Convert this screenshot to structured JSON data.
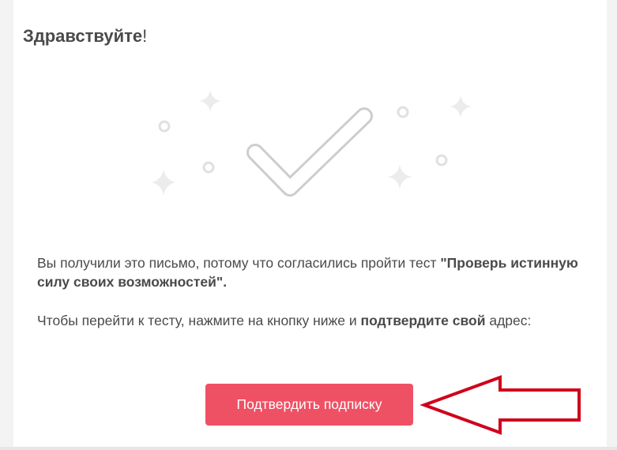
{
  "greeting": {
    "word": "Здравствуйте",
    "punct": "!"
  },
  "message": {
    "p1_text": "Вы получили это письмо, потому что согласились пройти тест ",
    "p1_bold": "\"Проверь истинную силу своих возможностей\".",
    "p2_text": "Чтобы перейти к тесту, нажмите на кнопку ниже и ",
    "p2_bold": "подтвердите свой",
    "p2_tail": " адрес:"
  },
  "button": {
    "label": "Подтвердить подписку",
    "color": "#ef5164"
  },
  "icons": {
    "illustration": "checkmark-icon",
    "decor": [
      "sparkle-icon",
      "ring-icon"
    ],
    "pointer": "arrow-left-icon"
  },
  "colors": {
    "text": "#4a4a4a",
    "arrow": "#d0021b",
    "decor": "#e6e6e6",
    "check": "#c8c8c8"
  }
}
